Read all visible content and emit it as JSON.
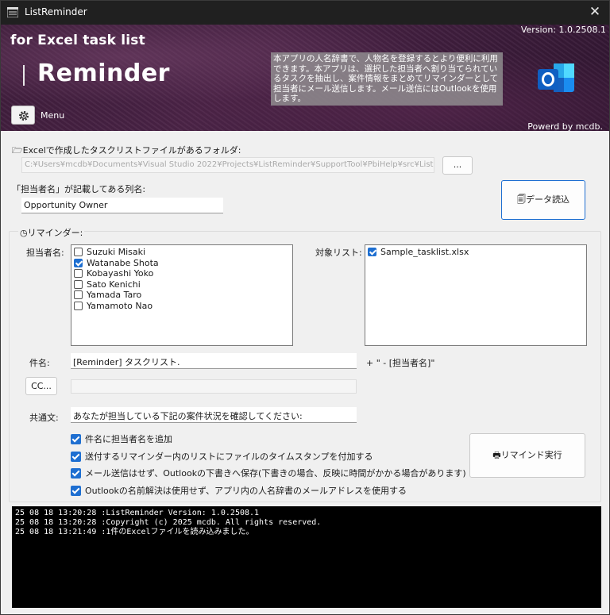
{
  "window": {
    "title": "ListReminder"
  },
  "banner": {
    "subtitle": "for Excel task list",
    "title": "Reminder",
    "version": "Version: 1.0.2508.1",
    "description": "本アプリの人名辞書で、人物名を登録するとより便利に利用できます。本アプリは、選択した担当者へ割り当てられているタスクを抽出し、案件情報をまとめてリマインダーとして担当者にメール送信します。メール送信にはOutlookを使用します。",
    "menu_label": "Menu",
    "powered": "Powerd by mcdb."
  },
  "folder": {
    "label": "Excelで作成したタスクリストファイルがあるフォルダ:",
    "path": "C:¥Users¥mcdb¥Documents¥Visual Studio 2022¥Projects¥ListReminder¥SupportTool¥PbiHelp¥src¥ListReminder¥",
    "browse_label": "..."
  },
  "column": {
    "label": "「担当者名」が記載してある列名:",
    "value": "Opportunity Owner"
  },
  "load_button": "データ読込",
  "reminder": {
    "group_label": "リマインダー:",
    "owners_label": "担当者名:",
    "owners": [
      {
        "name": "Suzuki Misaki",
        "checked": false
      },
      {
        "name": "Watanabe Shota",
        "checked": true
      },
      {
        "name": "Kobayashi Yoko",
        "checked": false
      },
      {
        "name": "Sato Kenichi",
        "checked": false
      },
      {
        "name": "Yamada Taro",
        "checked": false
      },
      {
        "name": "Yamamoto Nao",
        "checked": false
      }
    ],
    "targets_label": "対象リスト:",
    "targets": [
      {
        "name": "Sample_tasklist.xlsx",
        "checked": true
      }
    ],
    "subject_label": "件名:",
    "subject_value": "[Reminder] タスクリスト.",
    "subject_suffix": "+ \" - [担当者名]\"",
    "cc_button": "CC...",
    "cc_value": "",
    "body_label": "共通文:",
    "body_value": "あなたが担当している下記の案件状況を確認してください:",
    "options": [
      {
        "label": "件名に担当者名を追加",
        "checked": true
      },
      {
        "label": "送付するリマインダー内のリストにファイルのタイムスタンプを付加する",
        "checked": true
      },
      {
        "label": "メール送信はせず、Outlookの下書きへ保存(下書きの場合、反映に時間がかかる場合があります)",
        "checked": true
      },
      {
        "label": "Outlookの名前解決は使用せず、アプリ内の人名辞書のメールアドレスを使用する",
        "checked": true
      }
    ],
    "run_button": "リマインド実行"
  },
  "log": [
    "25 08 18 13:20:28 :ListReminder Version: 1.0.2508.1",
    "25 08 18 13:20:28 :Copyright (c) 2025 mcdb. All rights reserved.",
    "25 08 18 13:21:49 :1件のExcelファイルを読み込みました。"
  ],
  "colors": {
    "accent": "#1e6fd1",
    "banner": "#4a2346",
    "console_bg": "#000000"
  }
}
